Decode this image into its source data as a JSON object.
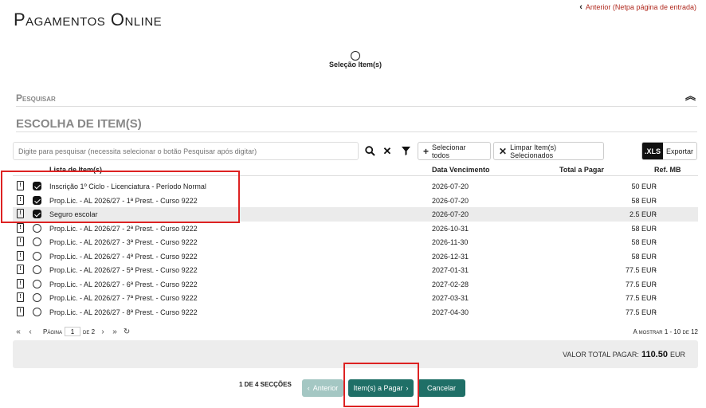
{
  "header": {
    "title": "Pagamentos Online",
    "back_link": "Anterior (Netpa página de entrada)"
  },
  "steps": {
    "current_label": "Seleção Item(s)"
  },
  "sections": {
    "search": "Pesquisar",
    "choose": "ESCOLHA DE ITEM(S)"
  },
  "toolbar": {
    "search_placeholder": "Digite para pesquisar (necessita selecionar o botão Pesquisar após digitar)",
    "select_all": "Selecionar todos",
    "clear_selected": "Limpar Item(s) Selecionados",
    "xls_badge": ".XLS",
    "export": "Exportar"
  },
  "table": {
    "headers": {
      "name": "Lista de Item(s)",
      "date": "Data Vencimento",
      "total": "Total a Pagar",
      "ref": "Ref. MB"
    },
    "rows": [
      {
        "name": "Inscrição 1º Ciclo - Licenciatura - Período Normal",
        "date": "2026-07-20",
        "total": "50 EUR",
        "ref": "-",
        "checked": true
      },
      {
        "name": "Prop.Lic. - AL 2026/27 - 1ª Prest. - Curso 9222",
        "date": "2026-07-20",
        "total": "58 EUR",
        "ref": "-",
        "checked": true
      },
      {
        "name": "Seguro escolar",
        "date": "2026-07-20",
        "total": "2.5 EUR",
        "ref": "-",
        "checked": true
      },
      {
        "name": "Prop.Lic. - AL 2026/27 - 2ª Prest. - Curso 9222",
        "date": "2026-10-31",
        "total": "58 EUR",
        "ref": "-",
        "checked": false
      },
      {
        "name": "Prop.Lic. - AL 2026/27 - 3ª Prest. - Curso 9222",
        "date": "2026-11-30",
        "total": "58 EUR",
        "ref": "-",
        "checked": false
      },
      {
        "name": "Prop.Lic. - AL 2026/27 - 4ª Prest. - Curso 9222",
        "date": "2026-12-31",
        "total": "58 EUR",
        "ref": "-",
        "checked": false
      },
      {
        "name": "Prop.Lic. - AL 2026/27 - 5ª Prest. - Curso 9222",
        "date": "2027-01-31",
        "total": "77.5 EUR",
        "ref": "-",
        "checked": false
      },
      {
        "name": "Prop.Lic. - AL 2026/27 - 6ª Prest. - Curso 9222",
        "date": "2027-02-28",
        "total": "77.5 EUR",
        "ref": "-",
        "checked": false
      },
      {
        "name": "Prop.Lic. - AL 2026/27 - 7ª Prest. - Curso 9222",
        "date": "2027-03-31",
        "total": "77.5 EUR",
        "ref": "-",
        "checked": false
      },
      {
        "name": "Prop.Lic. - AL 2026/27 - 8ª Prest. - Curso 9222",
        "date": "2027-04-30",
        "total": "77.5 EUR",
        "ref": "-",
        "checked": false
      }
    ]
  },
  "pager": {
    "page_label": "Página",
    "page": "1",
    "of_label": "de 2",
    "range": "A mostrar 1 - 10 de 12"
  },
  "totals": {
    "label": "VALOR TOTAL PAGAR:",
    "value": "110.50",
    "currency": "EUR"
  },
  "footer": {
    "sections": "1 DE 4 SECÇÕES",
    "prev": "Anterior",
    "next": "Item(s) a Pagar",
    "cancel": "Cancelar"
  },
  "colors": {
    "accent": "#1f6f67",
    "accent_disabled": "#a4c7c3",
    "highlight": "#dd2222",
    "link": "#b02a1f"
  }
}
